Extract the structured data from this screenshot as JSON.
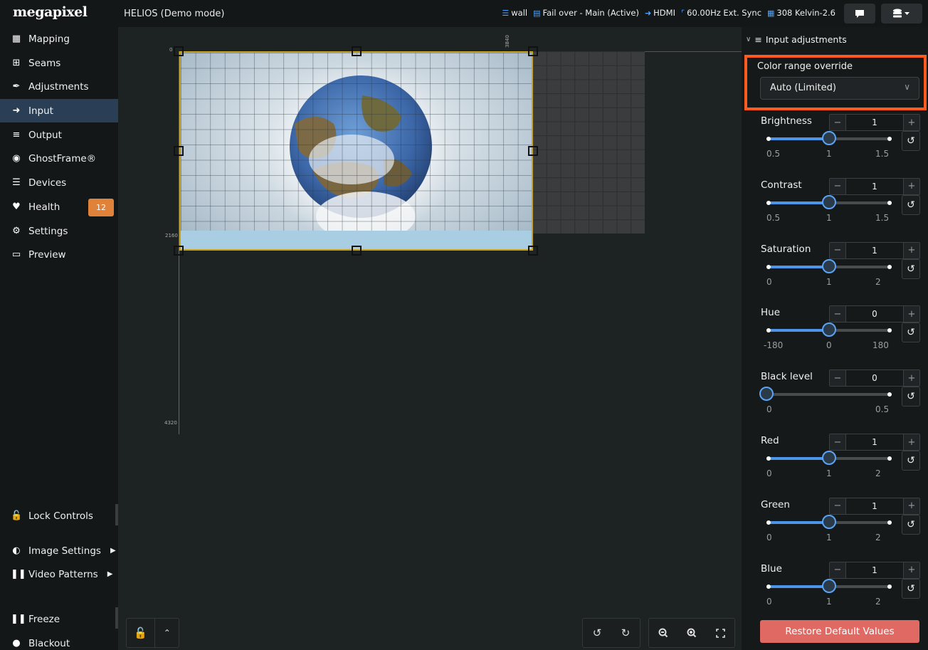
{
  "app": {
    "logo": "megapixel",
    "title": "HELIOS (Demo mode)"
  },
  "status": [
    {
      "icon": "database-icon",
      "label": "wall"
    },
    {
      "icon": "server-icon",
      "label": "Fail over - Main (Active)"
    },
    {
      "icon": "input-icon",
      "label": "HDMI"
    },
    {
      "icon": "pulse-icon",
      "label": "60.00Hz Ext. Sync"
    },
    {
      "icon": "grid-icon",
      "label": "308 Kelvin-2.6"
    }
  ],
  "sidebar": {
    "items": [
      {
        "label": "Mapping",
        "icon": "table-icon"
      },
      {
        "label": "Seams",
        "icon": "plus-square-icon"
      },
      {
        "label": "Adjustments",
        "icon": "brush-icon"
      },
      {
        "label": "Input",
        "icon": "sign-in-icon"
      },
      {
        "label": "Output",
        "icon": "sliders-icon"
      },
      {
        "label": "GhostFrame®",
        "icon": "ghostframe-icon"
      },
      {
        "label": "Devices",
        "icon": "list-icon"
      },
      {
        "label": "Health",
        "icon": "heartbeat-icon",
        "badge": "12"
      },
      {
        "label": "Settings",
        "icon": "cogs-icon"
      },
      {
        "label": "Preview",
        "icon": "monitor-icon"
      }
    ],
    "lock_controls": "Lock Controls",
    "image_settings": "Image Settings",
    "video_patterns": "Video Patterns",
    "freeze": "Freeze",
    "blackout": "Blackout"
  },
  "canvas": {
    "ruler_labels": {
      "left_top": "0",
      "left_mid": "2160",
      "left_bottom": "4320",
      "top_right": "3840"
    }
  },
  "panel": {
    "header": "Input adjustments",
    "color_range": {
      "label": "Color range override",
      "value": "Auto (Limited)"
    },
    "adjustments": [
      {
        "name": "Brightness",
        "value": "1",
        "ticks": [
          "0.5",
          "1",
          "1.5"
        ],
        "level": 0.5
      },
      {
        "name": "Contrast",
        "value": "1",
        "ticks": [
          "0.5",
          "1",
          "1.5"
        ],
        "level": 0.5
      },
      {
        "name": "Saturation",
        "value": "1",
        "ticks": [
          "0",
          "1",
          "2"
        ],
        "level": 0.5
      },
      {
        "name": "Hue",
        "value": "0",
        "ticks": [
          "-180",
          "0",
          "180"
        ],
        "level": 0.5
      },
      {
        "name": "Black level",
        "value": "0",
        "ticks": [
          "0",
          "0.5"
        ],
        "level": 0.0
      },
      {
        "name": "Red",
        "value": "1",
        "ticks": [
          "0",
          "1",
          "2"
        ],
        "level": 0.5
      },
      {
        "name": "Green",
        "value": "1",
        "ticks": [
          "0",
          "1",
          "2"
        ],
        "level": 0.5
      },
      {
        "name": "Blue",
        "value": "1",
        "ticks": [
          "0",
          "1",
          "2"
        ],
        "level": 0.5
      }
    ],
    "restore_label": "Restore Default Values"
  },
  "colors": {
    "accent": "#4d95ea",
    "highlight": "#ff5a1f",
    "badge": "#e0823a",
    "restore": "#e06a63",
    "active_nav": "#2a3f55"
  }
}
